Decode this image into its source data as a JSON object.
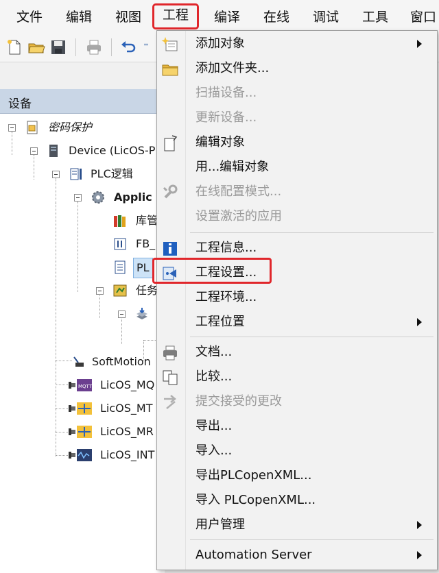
{
  "menubar": {
    "items": [
      {
        "label": "文件"
      },
      {
        "label": "编辑"
      },
      {
        "label": "视图"
      },
      {
        "label": "工程"
      },
      {
        "label": "编译"
      },
      {
        "label": "在线"
      },
      {
        "label": "调试"
      },
      {
        "label": "工具"
      },
      {
        "label": "窗口"
      }
    ],
    "active_index": 3
  },
  "toolbar": {
    "icons": [
      "new-file-icon",
      "open-folder-icon",
      "save-icon",
      "print-icon",
      "undo-icon",
      "redo-icon"
    ]
  },
  "device_panel": {
    "title": "设备",
    "tree": [
      {
        "label": "密码保护",
        "icon": "project-icon",
        "expanded": true
      },
      {
        "label": "Device (LicOS-P",
        "icon": "device-icon",
        "expanded": true
      },
      {
        "label": "PLC逻辑",
        "icon": "plc-logic-icon",
        "expanded": true
      },
      {
        "label": "Applic",
        "icon": "gear-icon",
        "expanded": true
      },
      {
        "label": "库管",
        "icon": "library-icon"
      },
      {
        "label": "FB_",
        "icon": "function-block-icon"
      },
      {
        "label": "PL",
        "icon": "program-icon",
        "selected": true
      },
      {
        "label": "任务",
        "icon": "task-config-icon",
        "expanded": true
      },
      {
        "label": "",
        "icon": "task-icon",
        "expanded": true
      },
      {
        "label": "SoftMotion",
        "icon": "softmotion-icon"
      },
      {
        "label": "LicOS_MQ",
        "icon": "mqtt-icon"
      },
      {
        "label": "LicOS_MT",
        "icon": "module-icon"
      },
      {
        "label": "LicOS_MR",
        "icon": "module-icon"
      },
      {
        "label": "LicOS_INT",
        "icon": "signal-icon"
      }
    ]
  },
  "project_menu": {
    "items": [
      {
        "label": "添加对象",
        "icon": "add-object-icon",
        "submenu": true,
        "disabled": false
      },
      {
        "label": "添加文件夹...",
        "icon": "folder-icon",
        "submenu": false,
        "disabled": false
      },
      {
        "label": "扫描设备...",
        "icon": "",
        "submenu": false,
        "disabled": true
      },
      {
        "label": "更新设备...",
        "icon": "",
        "submenu": false,
        "disabled": true
      },
      {
        "label": "编辑对象",
        "icon": "edit-object-icon",
        "submenu": false,
        "disabled": false
      },
      {
        "label": "用...编辑对象",
        "icon": "",
        "submenu": false,
        "disabled": false
      },
      {
        "label": "在线配置模式...",
        "icon": "wrench-icon",
        "submenu": false,
        "disabled": true
      },
      {
        "label": "设置激活的应用",
        "icon": "",
        "submenu": false,
        "disabled": true
      },
      {
        "label": "工程信息...",
        "icon": "info-icon",
        "submenu": false,
        "disabled": false
      },
      {
        "label": "工程设置...",
        "icon": "settings-icon",
        "submenu": false,
        "disabled": false,
        "highlighted": true
      },
      {
        "label": "工程环境...",
        "icon": "",
        "submenu": false,
        "disabled": false
      },
      {
        "label": "工程位置",
        "icon": "",
        "submenu": true,
        "disabled": false
      },
      {
        "label": "文档...",
        "icon": "print-icon",
        "submenu": false,
        "disabled": false
      },
      {
        "label": "比较...",
        "icon": "compare-icon",
        "submenu": false,
        "disabled": false
      },
      {
        "label": "提交接受的更改",
        "icon": "commit-icon",
        "submenu": false,
        "disabled": true
      },
      {
        "label": "导出...",
        "icon": "",
        "submenu": false,
        "disabled": false
      },
      {
        "label": "导入...",
        "icon": "",
        "submenu": false,
        "disabled": false
      },
      {
        "label": "导出PLCopenXML...",
        "icon": "",
        "submenu": false,
        "disabled": false
      },
      {
        "label": "导入 PLCopenXML...",
        "icon": "",
        "submenu": false,
        "disabled": false
      },
      {
        "label": "用户管理",
        "icon": "",
        "submenu": true,
        "disabled": false
      },
      {
        "label": "Automation Server",
        "icon": "",
        "submenu": true,
        "disabled": false
      }
    ]
  },
  "colors": {
    "highlight_border": "#e0262b",
    "panel_header": "#c9d6e6",
    "disabled_text": "#9a9a9a",
    "selection": "#cde3f7"
  }
}
